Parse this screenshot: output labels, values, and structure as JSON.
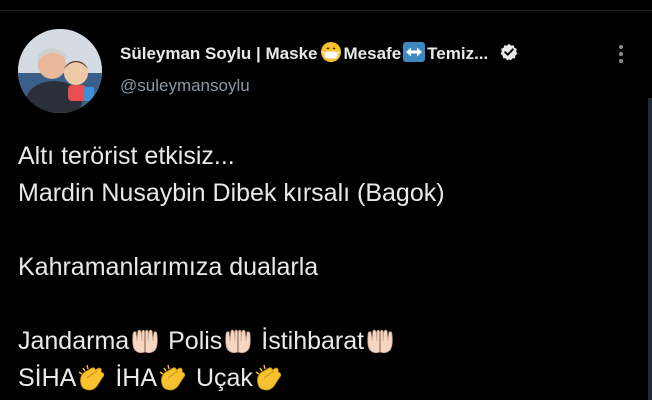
{
  "profile": {
    "display_name": "Süleyman Soylu | Maske",
    "name_part2": "Mesafe",
    "name_part3": "Temiz...",
    "handle": "@suleymansoylu",
    "verified": true,
    "icons": [
      "mask-emoji-icon",
      "left-right-arrow-emoji-icon",
      "verified-badge-icon",
      "more-options-icon"
    ]
  },
  "tweet": {
    "line1": "Altı terörist etkisiz...",
    "line2": "Mardin Nusaybin Dibek kırsalı (Bagok)",
    "line3": "Kahramanlarımıza dualarla",
    "forces1": [
      "Jandarma",
      "Polis",
      "İstihbarat"
    ],
    "forces2": [
      "SİHA",
      "İHA",
      "Uçak"
    ],
    "emoji_icons": [
      "palms-up-together-emoji-icon",
      "clapping-hands-emoji-icon"
    ]
  },
  "colors": {
    "background": "#000000",
    "text": "#e7e9ea",
    "secondary_text": "#8b98a5",
    "emoji_yellow": "#f9c22e"
  }
}
